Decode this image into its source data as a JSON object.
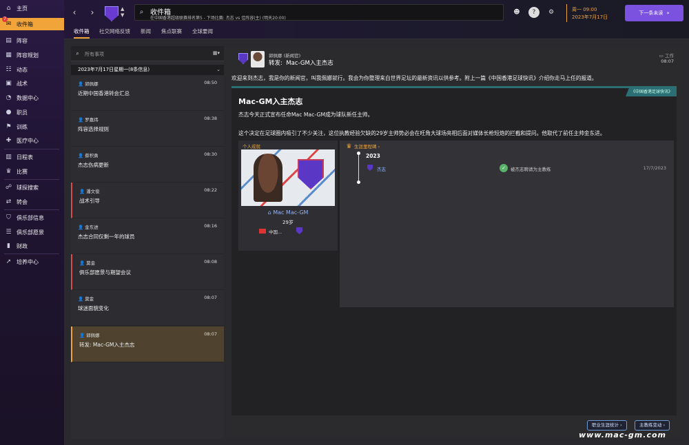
{
  "sidebar": {
    "items": [
      {
        "label": "主页",
        "icon": "home-icon"
      },
      {
        "label": "收件箱",
        "icon": "inbox-icon",
        "badge": "7"
      },
      {
        "label": "阵容",
        "icon": "squad-icon"
      },
      {
        "label": "阵容规划",
        "icon": "squad-planner-icon"
      },
      {
        "label": "动态",
        "icon": "dynamics-icon"
      },
      {
        "label": "战术",
        "icon": "tactics-icon"
      },
      {
        "label": "数据中心",
        "icon": "data-hub-icon"
      },
      {
        "label": "职员",
        "icon": "staff-icon"
      },
      {
        "label": "训练",
        "icon": "training-icon"
      },
      {
        "label": "医疗中心",
        "icon": "medical-icon"
      },
      {
        "label": "日程表",
        "icon": "calendar-icon"
      },
      {
        "label": "比赛",
        "icon": "trophy-icon"
      },
      {
        "label": "球探搜索",
        "icon": "scouting-icon"
      },
      {
        "label": "转会",
        "icon": "transfers-icon"
      },
      {
        "label": "俱乐部信息",
        "icon": "club-info-icon"
      },
      {
        "label": "俱乐部愿景",
        "icon": "club-vision-icon"
      },
      {
        "label": "财政",
        "icon": "finances-icon"
      },
      {
        "label": "培养中心",
        "icon": "development-icon"
      }
    ]
  },
  "topbar": {
    "title": "收件箱",
    "subtitle": "在中国香港超级联赛排名第5 - 下场比赛: 杰志 vs 佳阵容(主) (明天20:00)",
    "day_time": "周一 09:00",
    "date": "2023年7月17日",
    "next_label": "下一条未读",
    "tabs": [
      "收件箱",
      "社交网络反馈",
      "新闻",
      "焦点联赛",
      "全球要闻"
    ]
  },
  "inbox": {
    "search_placeholder": "所有事项",
    "date_group": "2023年7月17日星期一(8条信息)",
    "messages": [
      {
        "sender": "郭佩娜",
        "time": "08:50",
        "subject": "近期中国香港转会汇总"
      },
      {
        "sender": "罗嘉炜",
        "time": "08:38",
        "subject": "阵容选择规则"
      },
      {
        "sender": "蔡积勇",
        "time": "08:30",
        "subject": "杰志伤病更新"
      },
      {
        "sender": "潘文俊",
        "time": "08:22",
        "subject": "战术引导"
      },
      {
        "sender": "金东进",
        "time": "08:16",
        "subject": "杰志合同仅剩一年的球员"
      },
      {
        "sender": "莫金",
        "time": "08:08",
        "subject": "俱乐部愿景与期望会议"
      },
      {
        "sender": "莫金",
        "time": "08:07",
        "subject": "球迷面貌变化"
      },
      {
        "sender": "郭佩娜",
        "time": "08:07",
        "subject": "转发:  Mac-GM入主杰志"
      }
    ]
  },
  "reader": {
    "from": "郭佩娜 (新闻官)",
    "subject_prefix": "转发:",
    "subject": "Mac-GM入主杰志",
    "tag": "工作",
    "time": "08:07",
    "intro": "欢迎来到杰志，我是你的新闻官，叫我佩娜就行。我会为你整理来自世界足坛的最新资讯以供参考。附上一篇《中国香港足球快讯》介绍你走马上任的报道。",
    "article": {
      "source": "《中国香港足球快讯》",
      "title": "Mac-GM入主杰志",
      "p1": "杰志今天正式宣布任命Mac Mac-GM成为球队新任主帅。",
      "p2": "这个决定在足球圈内吸引了不少关注，这位执教经验欠缺的29岁主帅势必会在旺角大球场亮相后面对媒体长枪短炮的拦截和提问。他取代了前任主帅金东进。"
    },
    "profile": {
      "label": "个人成就",
      "name": "Mac Mac-GM",
      "age": "29岁",
      "nationality": "中国..."
    },
    "career": {
      "label": "生涯里程碑",
      "year": "2023",
      "club": "杰志",
      "event": "被杰志聘请为主教练",
      "date": "17/7/2023"
    },
    "buttons": {
      "career_stats": "职业生涯统计",
      "manager_changes": "主教练变动"
    }
  },
  "watermark": "www.mac-gm.com",
  "colors": {
    "accent": "#f0a43a",
    "primary_button": "#7b52e0",
    "news_banner": "#2b6f74",
    "link": "#8fb4ff",
    "flag_red": "#d94b4b"
  }
}
